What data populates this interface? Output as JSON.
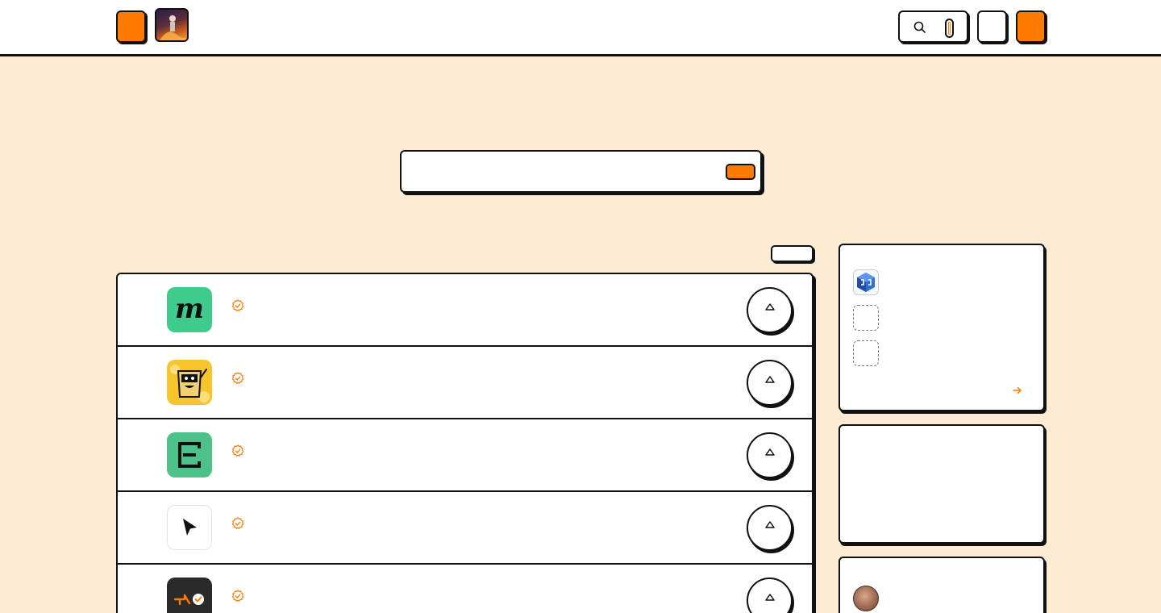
{
  "header": {
    "search": {
      "placeholder": "",
      "shortcut": ""
    }
  },
  "hero": {
    "search_placeholder": "",
    "search_value": ""
  },
  "list": {
    "sort_label": "",
    "products": [
      {
        "name": "",
        "upvotes": "",
        "logo": "m-letter-logo",
        "verified": true
      },
      {
        "name": "",
        "upvotes": "",
        "logo": "yellow-character-logo",
        "verified": true
      },
      {
        "name": "",
        "upvotes": "",
        "logo": "e-bracket-logo",
        "verified": true
      },
      {
        "name": "",
        "upvotes": "",
        "logo": "cursor-arrow-logo",
        "verified": true
      },
      {
        "name": "",
        "upvotes": "",
        "logo": "dark-check-logo",
        "verified": true
      }
    ]
  },
  "sidebar": {
    "card1": {
      "title": "",
      "items": [
        "",
        "",
        ""
      ]
    },
    "card2": {
      "title": ""
    },
    "card3": {
      "title": ""
    }
  },
  "colors": {
    "accent": "#ff7b00",
    "background": "#fdebd3",
    "ink": "#111111",
    "surface": "#ffffff"
  }
}
